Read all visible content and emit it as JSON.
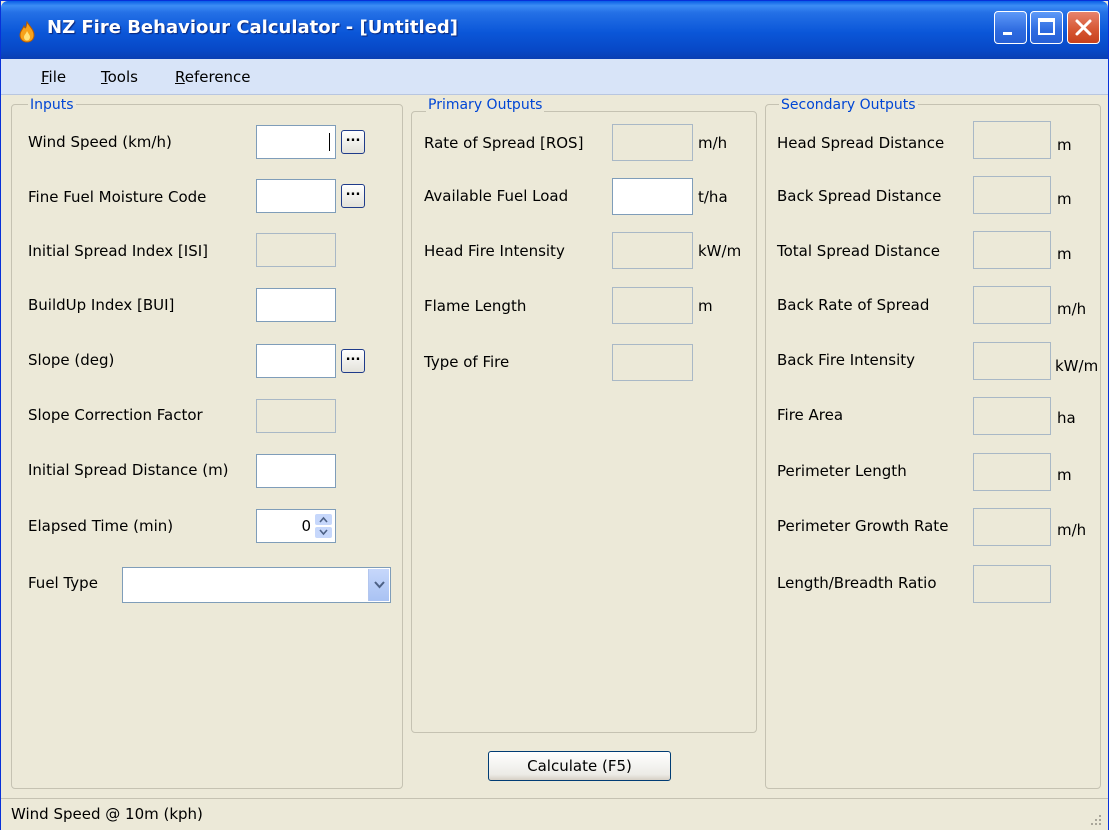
{
  "window": {
    "title": "NZ Fire Behaviour Calculator - [Untitled]",
    "icons": [
      "flame-icon",
      "minimize-icon",
      "maximize-icon",
      "close-icon"
    ]
  },
  "menu": {
    "file": "File",
    "tools": "Tools",
    "reference": "Reference"
  },
  "inputs": {
    "title": "Inputs",
    "wind_speed": {
      "label": "Wind Speed (km/h)",
      "value": ""
    },
    "ffmc": {
      "label": "Fine Fuel Moisture Code",
      "value": ""
    },
    "isi": {
      "label": "Initial Spread Index [ISI]",
      "value": ""
    },
    "bui": {
      "label": "BuildUp Index [BUI]",
      "value": ""
    },
    "slope": {
      "label": "Slope (deg)",
      "value": ""
    },
    "slope_cf": {
      "label": "Slope Correction Factor",
      "value": ""
    },
    "isd": {
      "label": "Initial Spread Distance (m)",
      "value": ""
    },
    "elapsed": {
      "label": "Elapsed Time (min)",
      "value": "0"
    },
    "fuel_type": {
      "label": "Fuel Type",
      "value": ""
    }
  },
  "primary": {
    "title": "Primary Outputs",
    "ros": {
      "label": "Rate of Spread [ROS]",
      "unit": "m/h"
    },
    "fuel_load": {
      "label": "Available Fuel Load",
      "unit": "t/ha"
    },
    "hfi": {
      "label": "Head Fire Intensity",
      "unit": "kW/m"
    },
    "flame": {
      "label": "Flame Length",
      "unit": "m"
    },
    "fire_type": {
      "label": "Type of Fire",
      "unit": ""
    }
  },
  "secondary": {
    "title": "Secondary Outputs",
    "head_dist": {
      "label": "Head Spread Distance",
      "unit": "m"
    },
    "back_dist": {
      "label": "Back Spread Distance",
      "unit": "m"
    },
    "total_dist": {
      "label": "Total Spread Distance",
      "unit": "m"
    },
    "back_ros": {
      "label": "Back Rate of Spread",
      "unit": "m/h"
    },
    "back_fi": {
      "label": "Back Fire Intensity",
      "unit": "kW/m"
    },
    "area": {
      "label": "Fire Area",
      "unit": "ha"
    },
    "perimeter": {
      "label": "Perimeter Length",
      "unit": "m"
    },
    "perim_growth": {
      "label": "Perimeter Growth Rate",
      "unit": "m/h"
    },
    "lb_ratio": {
      "label": "Length/Breadth Ratio",
      "unit": ""
    }
  },
  "calculate_label": "Calculate  (F5)",
  "ellipsis_label": "...",
  "status": "Wind Speed @ 10m (kph)"
}
